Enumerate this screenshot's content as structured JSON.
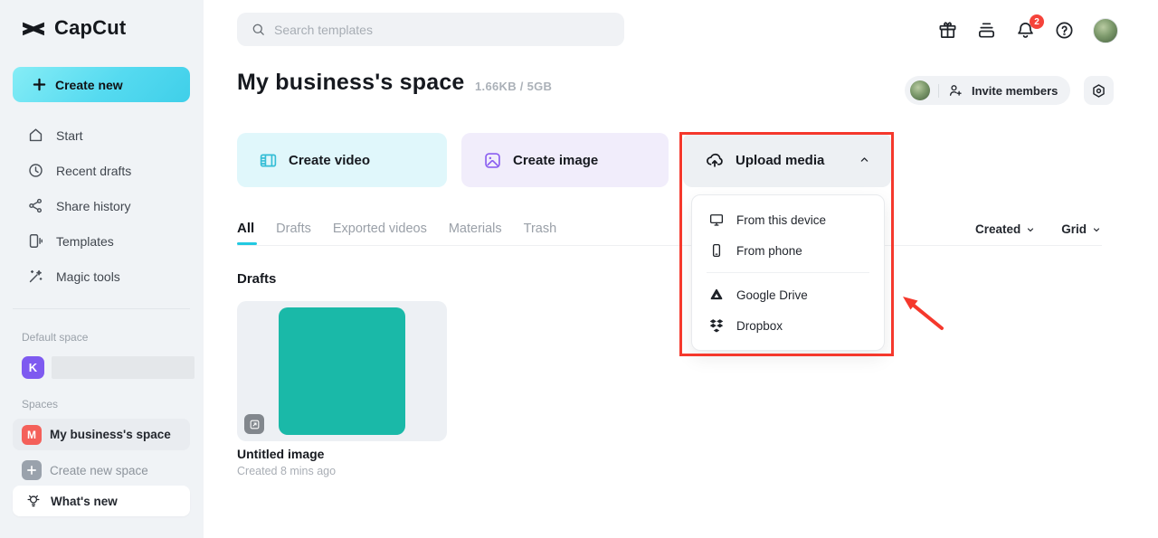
{
  "brand": {
    "name": "CapCut"
  },
  "sidebar": {
    "create_new_label": "Create new",
    "nav": [
      {
        "label": "Start"
      },
      {
        "label": "Recent drafts"
      },
      {
        "label": "Share history"
      },
      {
        "label": "Templates"
      },
      {
        "label": "Magic tools"
      }
    ],
    "default_space_label": "Default space",
    "default_space_initial": "K",
    "spaces_label": "Spaces",
    "space": {
      "initial": "M",
      "name": "My business's space"
    },
    "create_new_space_label": "Create new space",
    "whats_new_label": "What's new"
  },
  "topbar": {
    "search_placeholder": "Search templates",
    "notification_count": "2"
  },
  "header": {
    "title": "My business's space",
    "storage": "1.66KB / 5GB",
    "invite_label": "Invite members"
  },
  "actions": {
    "create_video": "Create video",
    "create_image": "Create image",
    "upload_media": "Upload media"
  },
  "upload_menu": {
    "items": [
      "From this device",
      "From phone",
      "Google Drive",
      "Dropbox"
    ]
  },
  "tabs": [
    "All",
    "Drafts",
    "Exported videos",
    "Materials",
    "Trash"
  ],
  "active_tab": "All",
  "filters": {
    "sort_label": "Created",
    "view_label": "Grid"
  },
  "content": {
    "drafts_heading": "Drafts",
    "draft": {
      "title": "Untitled image",
      "meta": "Created 8 mins ago"
    }
  },
  "colors": {
    "accent_cyan_gradient": "#3fcfe9",
    "tab_underline": "#22c9e1",
    "draft_teal": "#1ab9a8",
    "annotation_red": "#f5382c",
    "badge_red": "#f5433a",
    "avatar_purple": "#7e5af0",
    "avatar_coral": "#f4605a",
    "video_icon_teal": "#35bed6",
    "image_icon_purple": "#8a5ef0"
  }
}
